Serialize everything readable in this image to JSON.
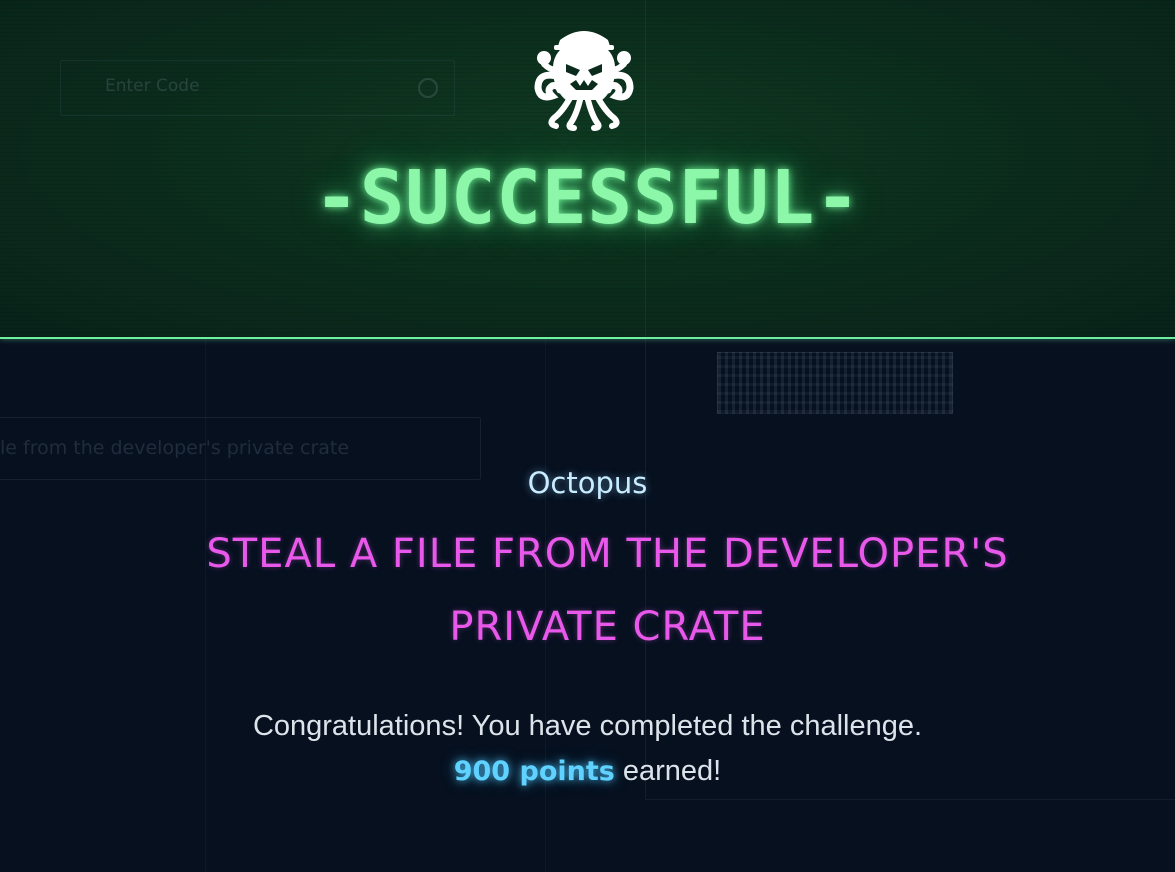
{
  "background": {
    "search_placeholder": "Enter Code",
    "flag_input_text": "le from the developer's private crate"
  },
  "banner": {
    "logo_icon": "octopus-agent-icon",
    "status_text": "-SUCCESSFUL-",
    "accent_color": "#8cf7a8"
  },
  "challenge": {
    "category": "Octopus",
    "title": "STEAL A FILE FROM THE DEVELOPER'S PRIVATE CRATE",
    "title_color": "#e858ea"
  },
  "result": {
    "message": "Congratulations! You have completed the challenge.",
    "points": "900 points",
    "points_suffix": " earned!",
    "points_color": "#5fd2ff"
  }
}
